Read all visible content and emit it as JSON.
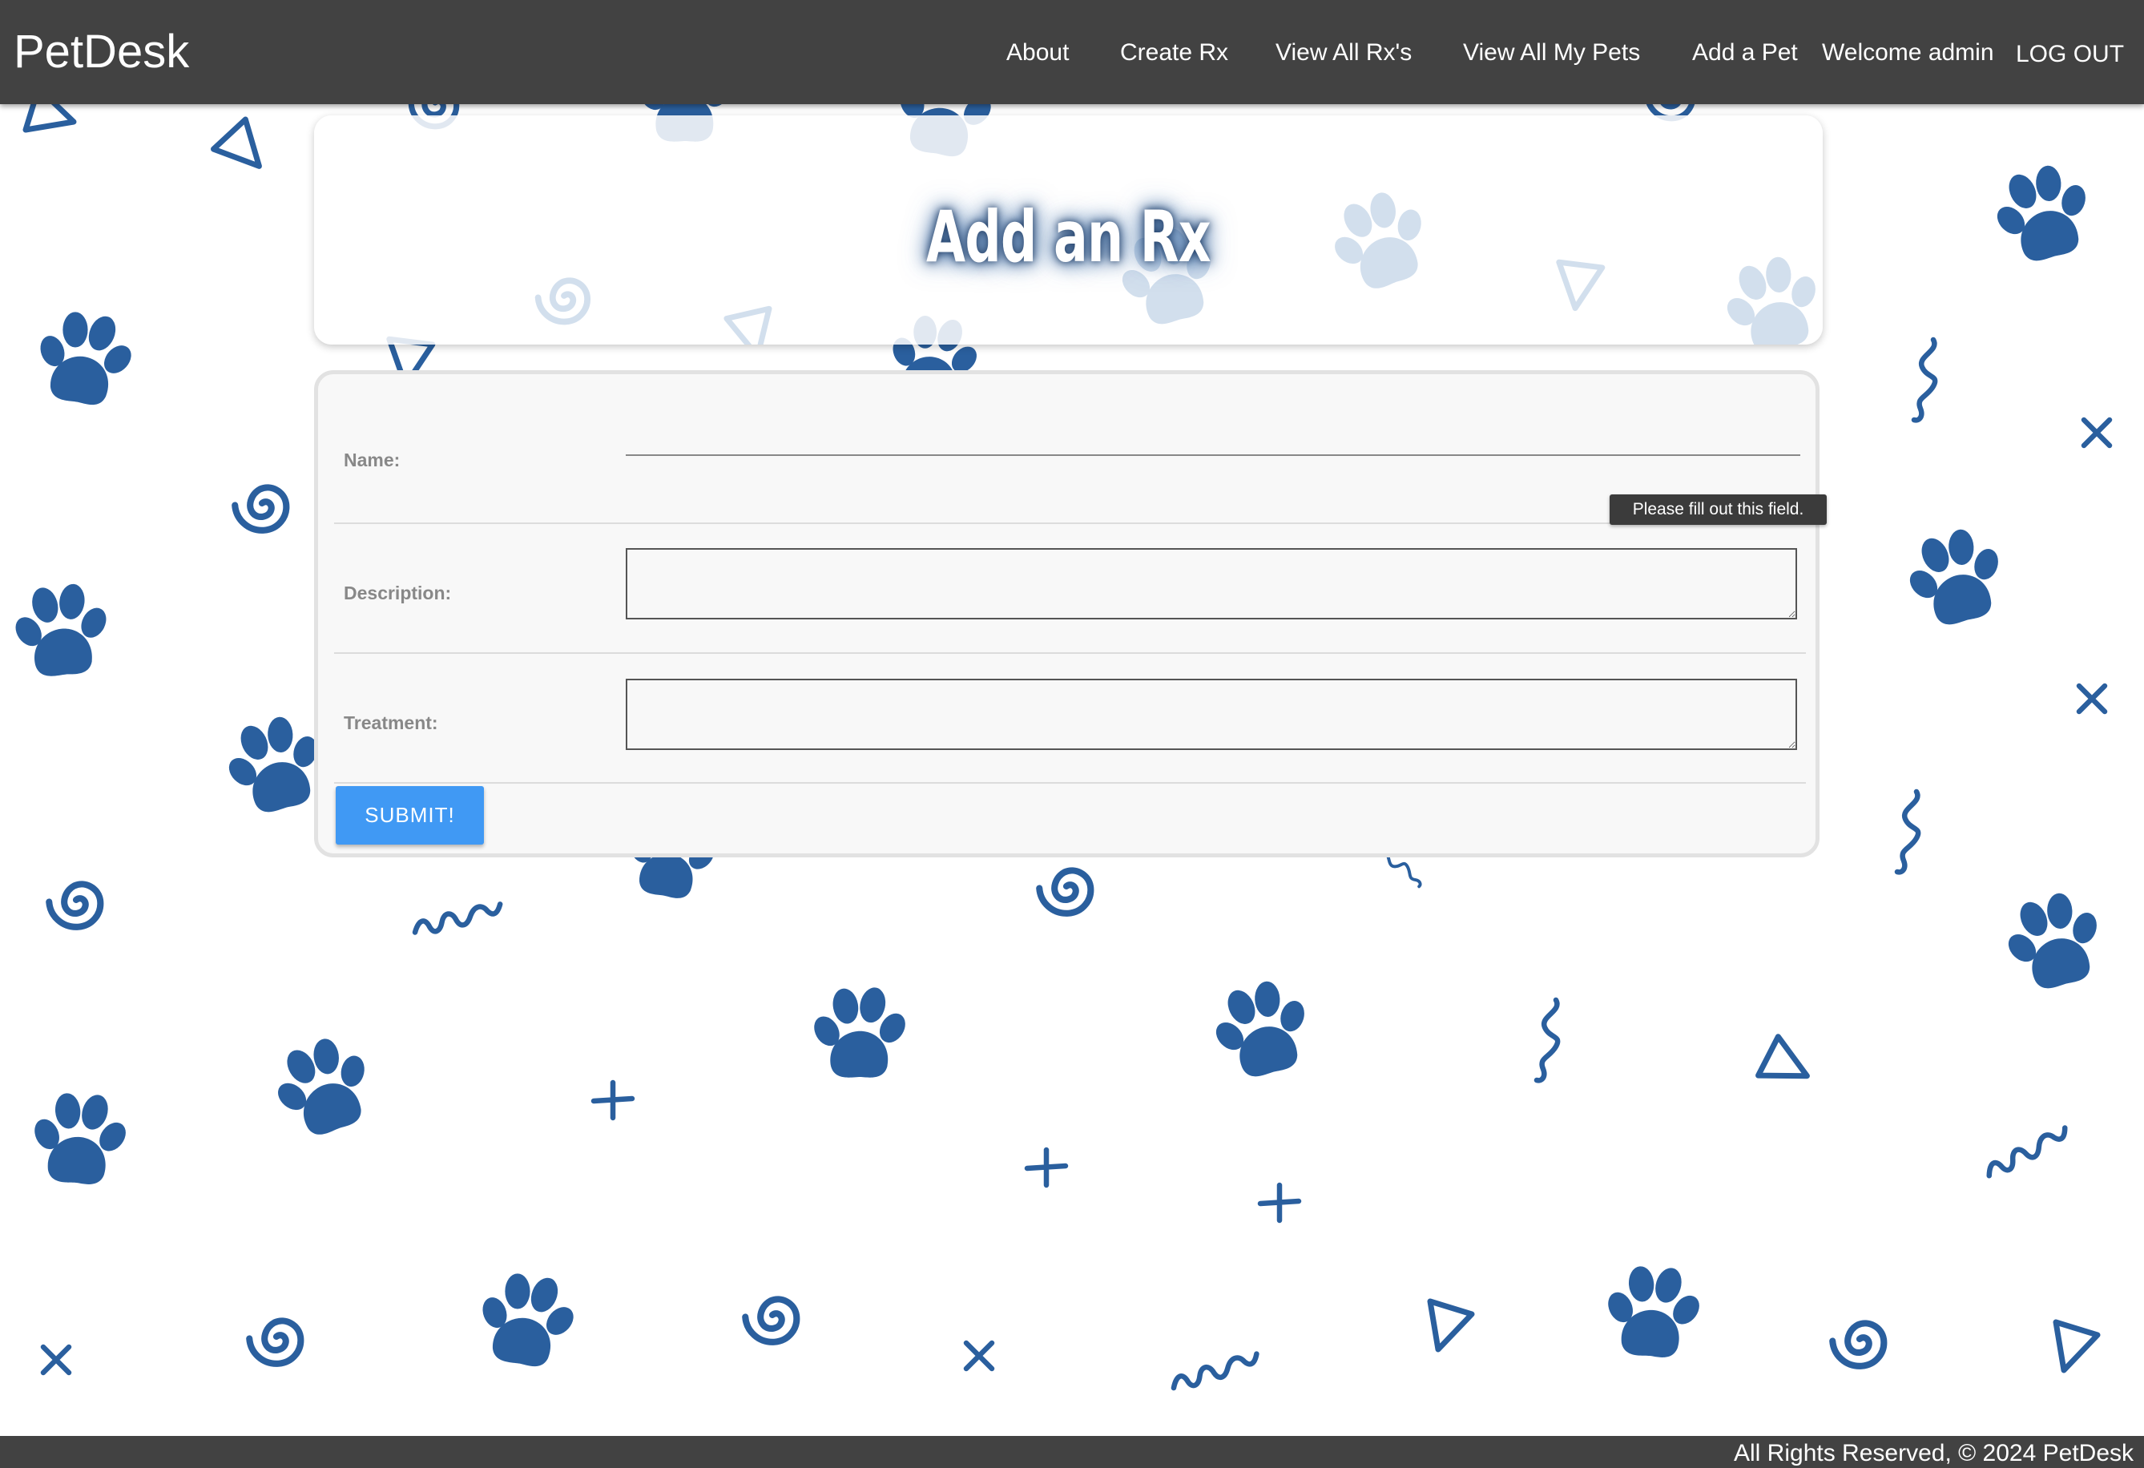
{
  "app": {
    "brand": "PetDesk",
    "accent_color": "#4099f4",
    "navbar_color": "#424242",
    "pattern_color": "#2a5f9e"
  },
  "nav": {
    "about": "About",
    "create_rx": "Create Rx",
    "view_all_rx": "View All Rx's",
    "view_all_my_pets": "View All My Pets",
    "add_a_pet": "Add a Pet",
    "welcome": "Welcome admin",
    "logout": "LOG OUT"
  },
  "page": {
    "title": "Add an Rx"
  },
  "form": {
    "name_label": "Name:",
    "name_value": "",
    "description_label": "Description:",
    "description_value": "",
    "treatment_label": "Treatment:",
    "treatment_value": "",
    "submit_label": "SUBMIT!"
  },
  "tooltip": {
    "text": "Please fill out this field."
  },
  "footer": {
    "text": "All Rights Reserved, © 2024 PetDesk"
  },
  "background": {
    "icons": [
      "paw-icon",
      "spiral-icon",
      "triangle-icon",
      "cross-icon",
      "plus-icon",
      "squiggle-icon"
    ]
  }
}
